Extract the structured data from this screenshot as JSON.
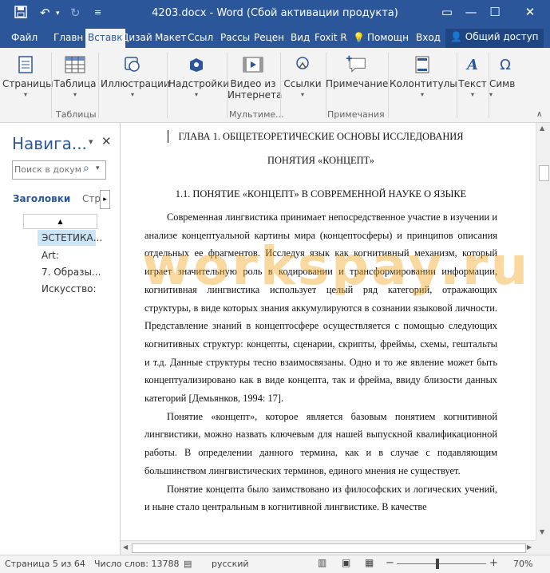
{
  "window": {
    "title": "4203.docx - Word (Сбой активации продукта)",
    "colors": {
      "accent": "#2b579a",
      "watermark": "#f4a41e"
    }
  },
  "tabs": [
    {
      "label": "Файл"
    },
    {
      "label": "Главн"
    },
    {
      "label": "Вставк"
    },
    {
      "label": "Дизай"
    },
    {
      "label": "Макет"
    },
    {
      "label": "Ссыл"
    },
    {
      "label": "Рассы"
    },
    {
      "label": "Рецен"
    },
    {
      "label": "Вид"
    },
    {
      "label": "Foxit R"
    },
    {
      "label": "Помощн"
    },
    {
      "label": "Вход"
    },
    {
      "label": "Общий доступ"
    }
  ],
  "ribbon": {
    "pages": "Страницы",
    "table": "Таблица",
    "illustrations": "Иллюстрации",
    "addins": "Надстройки",
    "video": [
      "Видео из",
      "Интернета"
    ],
    "links": "Ссылки",
    "comment": "Примечание",
    "headers": "Колонтитулы",
    "text": "Текст",
    "symbols": "Симв",
    "groups": {
      "tables": "Таблицы",
      "media": "Мультиме...",
      "comments": "Примечания"
    }
  },
  "nav": {
    "title": "Навига...",
    "search_placeholder": "Поиск в докум",
    "tab_headings": "Заголовки",
    "tab_pages": "Стра",
    "items": [
      "ЭСТЕТИКА...",
      "Art:",
      "7. Образы...",
      "Искусство:"
    ]
  },
  "document": {
    "heading1": "ГЛАВА 1. ОБЩЕТЕОРЕТИЧЕСКИЕ ОСНОВЫ ИССЛЕДОВАНИЯ",
    "heading2": "ПОНЯТИЯ «КОНЦЕПТ»",
    "heading3": "1.1. ПОНЯТИЕ «КОНЦЕПТ» В СОВРЕМЕННОЙ НАУКЕ О ЯЗЫКЕ",
    "para1": "Современная лингвистика принимает непосредственное участие в изучении и анализе концептуальной картины мира (концептосферы) и принципов описания отдельных ее фрагментов. Исследуя язык как когнитивный механизм, который играет значительную роль в кодировании и трансформировании информации, когнитивная лингвистика использует целый ряд категорий, отражающих структуры, в виде которых знания аккумулируются в сознании языковой личности. Представление знаний в концептосфере осуществляется с помощью следующих когнитивных структур: концепты, сценарии, скрипты, фреймы, схемы, гештальты и т.д. Данные структуры тесно взаимосвязаны. Одно и то же явление может быть концептуализировано как в виде концепта, так и фрейма, ввиду близости данных категорий [Демьянков, 1994: 17].",
    "para2": "Понятие «концепт», которое является базовым понятием когнитивной лингвистики, можно назвать ключевым для нашей выпускной квалификационной работы. В определении данного термина, как и в случае с подавляющим большинством лингвистических терминов, единого мнения не существует.",
    "para3": "Понятие концепта было заимствовано из философских и логических учений, и ныне стало центральным в когнитивной лингвистике. В качестве"
  },
  "watermark": "workspay.ru",
  "status": {
    "page": "Страница 5 из 64",
    "words": "Число слов: 13788",
    "language": "русский",
    "zoom": "70%"
  }
}
